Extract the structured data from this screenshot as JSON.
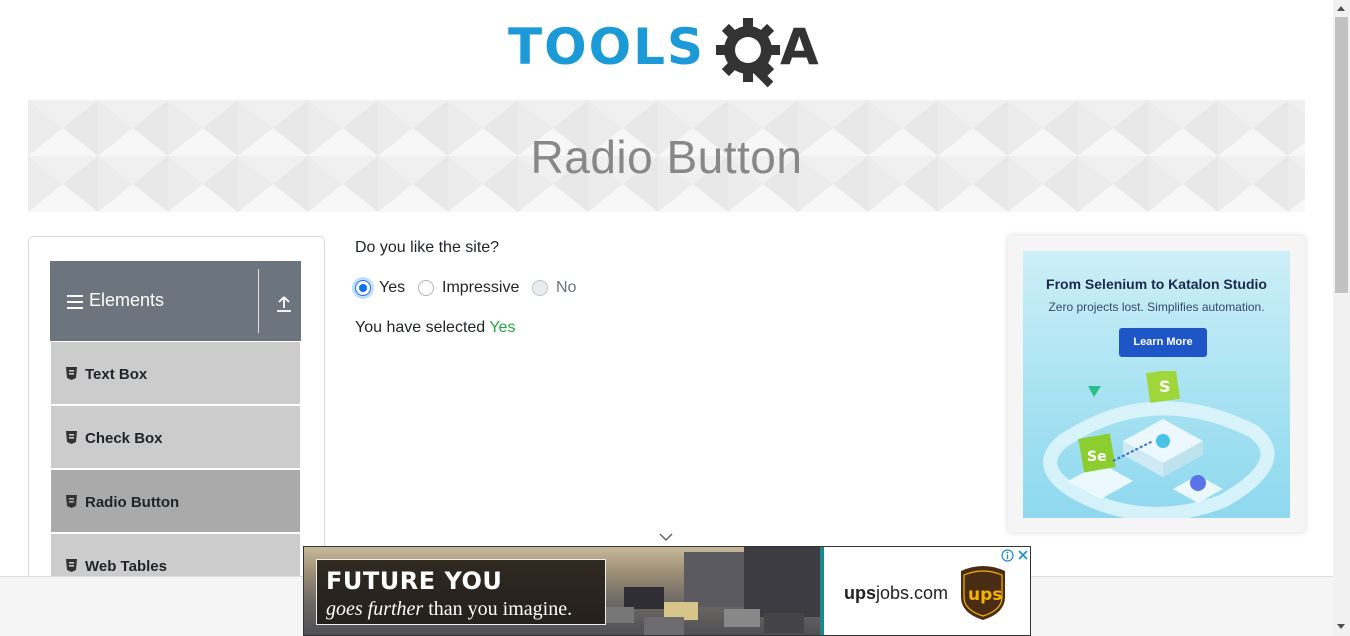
{
  "logo": {
    "part1": "TOOLS",
    "part2": "A"
  },
  "banner": {
    "title": "Radio Button"
  },
  "sidebar": {
    "group": {
      "label": "Elements"
    },
    "items": [
      {
        "label": "Text Box"
      },
      {
        "label": "Check Box"
      },
      {
        "label": "Radio Button",
        "active": true
      },
      {
        "label": "Web Tables"
      }
    ]
  },
  "main": {
    "question": "Do you like the site?",
    "options": [
      {
        "label": "Yes",
        "checked": true,
        "disabled": false
      },
      {
        "label": "Impressive",
        "checked": false,
        "disabled": false
      },
      {
        "label": "No",
        "checked": false,
        "disabled": true
      }
    ],
    "result_prefix": "You have selected",
    "result_value": "Yes"
  },
  "right_ad": {
    "title": "From Selenium to Katalon Studio",
    "subtitle": "Zero projects lost. Simplifies automation.",
    "button": "Learn More",
    "badge_s": "S",
    "badge_se": "Se"
  },
  "bottom_ad": {
    "headline": "FUTURE YOU",
    "tagline_italic": "goes further",
    "tagline_rest": "than you imagine.",
    "brand_bold": "ups",
    "brand_rest": "jobs.com",
    "logo_text": "ups"
  },
  "colors": {
    "brand_blue": "#1c9ad7",
    "sidebar_header": "#6c757d",
    "menu_item": "#cccccc",
    "menu_item_active": "#aaaaaa",
    "radio_checked": "#0d6efd",
    "result_green": "#28a745"
  }
}
